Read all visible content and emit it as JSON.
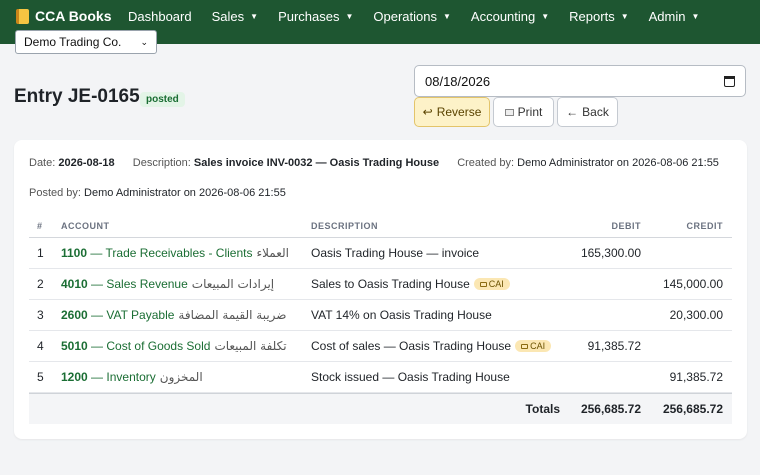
{
  "app": {
    "brand": "CCA Books",
    "nav": [
      "Dashboard",
      "Sales",
      "Purchases",
      "Operations",
      "Accounting",
      "Reports",
      "Admin"
    ],
    "company": "Demo Trading Co."
  },
  "entry": {
    "title": "Entry JE-0165",
    "status": "posted",
    "date_value": "08/18/2026",
    "buttons": {
      "reverse": "Reverse",
      "print": "Print",
      "back": "Back"
    },
    "reverse_icon": "↩",
    "back_icon": "←"
  },
  "meta": {
    "date_label": "Date:",
    "date_value": "2026-08-18",
    "description_label": "Description:",
    "description_value": "Sales invoice INV-0032 — Oasis Trading House",
    "created_label": "Created by:",
    "created_value": "Demo Administrator on 2026-08-06 21:55",
    "posted_label": "Posted by:",
    "posted_value": "Demo Administrator on 2026-08-06 21:55"
  },
  "table": {
    "headers": {
      "num": "#",
      "account": "ACCOUNT",
      "description": "DESCRIPTION",
      "debit": "DEBIT",
      "credit": "CREDIT"
    },
    "rows": [
      {
        "num": "1",
        "code": "1100",
        "name": "— Trade Receivables - Clients",
        "arabic": "العملاء",
        "description": "Oasis Trading House — invoice",
        "tag": "",
        "debit": "165,300.00",
        "credit": ""
      },
      {
        "num": "2",
        "code": "4010",
        "name": "— Sales Revenue",
        "arabic": "إيرادات المبيعات",
        "description": "Sales to Oasis Trading House",
        "tag": "CAI",
        "debit": "",
        "credit": "145,000.00"
      },
      {
        "num": "3",
        "code": "2600",
        "name": "— VAT Payable",
        "arabic": "ضريبة القيمة المضافة",
        "description": "VAT 14% on Oasis Trading House",
        "tag": "",
        "debit": "",
        "credit": "20,300.00"
      },
      {
        "num": "4",
        "code": "5010",
        "name": "— Cost of Goods Sold",
        "arabic": "تكلفة المبيعات",
        "description": "Cost of sales — Oasis Trading House",
        "tag": "CAI",
        "debit": "91,385.72",
        "credit": ""
      },
      {
        "num": "5",
        "code": "1200",
        "name": "— Inventory",
        "arabic": "المخزون",
        "description": "Stock issued — Oasis Trading House",
        "tag": "",
        "debit": "",
        "credit": "91,385.72"
      }
    ],
    "totals": {
      "label": "Totals",
      "debit": "256,685.72",
      "credit": "256,685.72"
    }
  },
  "colors": {
    "nav_bg": "#1e5631",
    "accent_green": "#1b6e34",
    "reverse_bg": "#fdf2c8",
    "tag_bg": "#fbe7b3"
  }
}
